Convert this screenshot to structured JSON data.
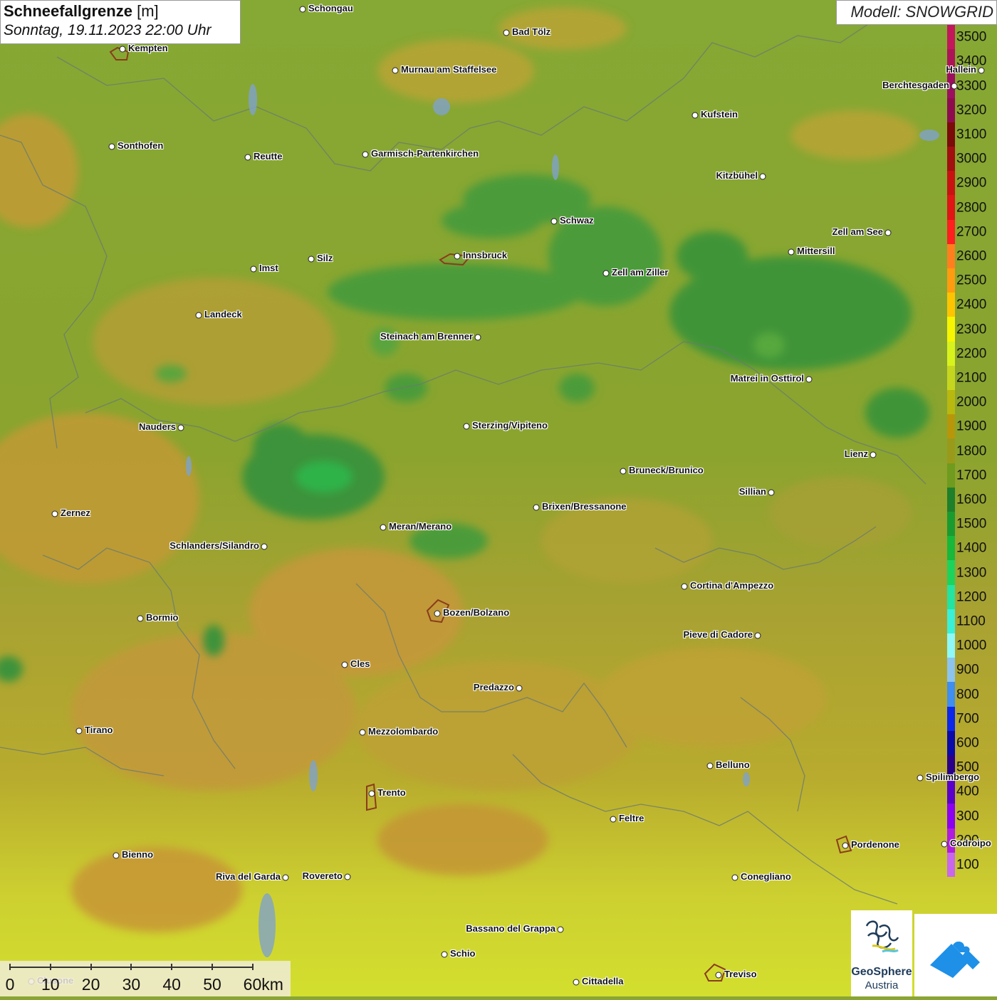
{
  "header": {
    "title_bold": "Schneefallgrenze",
    "title_unit": "[m]",
    "datetime": "Sonntag, 19.11.2023 22:00 Uhr",
    "model": "Modell: SNOWGRID"
  },
  "legend": {
    "values": [
      "3500",
      "3400",
      "3300",
      "3200",
      "3100",
      "3000",
      "2900",
      "2800",
      "2700",
      "2600",
      "2500",
      "2400",
      "2300",
      "2200",
      "2100",
      "2000",
      "1900",
      "1800",
      "1700",
      "1600",
      "1500",
      "1400",
      "1300",
      "1200",
      "1100",
      "1000",
      "900",
      "800",
      "700",
      "600",
      "500",
      "400",
      "300",
      "200",
      "100"
    ],
    "colors": [
      "#c2185b",
      "#ad1457",
      "#9c0f5f",
      "#8e0c4e",
      "#7b0a0a",
      "#a10f10",
      "#c81212",
      "#e01515",
      "#ff1f1f",
      "#ff7f1f",
      "#ff9b0f",
      "#ffc400",
      "#f7f500",
      "#d8f21c",
      "#c6d61e",
      "#b8b80f",
      "#b8960a",
      "#9a9a1a",
      "#6f9b1e",
      "#1f7f2a",
      "#1a9b2f",
      "#18b83a",
      "#1dd35c",
      "#25e3a0",
      "#3af0d6",
      "#8ff8f8",
      "#8cc4ee",
      "#3f8ef0",
      "#0b28e8",
      "#0a0aa8",
      "#2a0088",
      "#5a00c8",
      "#8c00f0",
      "#b01cde",
      "#c967ec"
    ]
  },
  "cities": [
    {
      "name": "Schongau",
      "label_side": "right"
    },
    {
      "name": "Bad Tölz",
      "label_side": "right"
    },
    {
      "name": "Kempten",
      "label_side": "right"
    },
    {
      "name": "Murnau am Staffelsee",
      "label_side": "right"
    },
    {
      "name": "Hallein",
      "label_side": "left"
    },
    {
      "name": "Berchtesgaden",
      "label_side": "left"
    },
    {
      "name": "Kufstein",
      "label_side": "right"
    },
    {
      "name": "Sonthofen",
      "label_side": "right"
    },
    {
      "name": "Reutte",
      "label_side": "right"
    },
    {
      "name": "Garmisch-Partenkirchen",
      "label_side": "right"
    },
    {
      "name": "Kitzbühel",
      "label_side": "left"
    },
    {
      "name": "Schwaz",
      "label_side": "right"
    },
    {
      "name": "Zell am See",
      "label_side": "left"
    },
    {
      "name": "Innsbruck",
      "label_side": "right"
    },
    {
      "name": "Mittersill",
      "label_side": "right"
    },
    {
      "name": "Silz",
      "label_side": "right"
    },
    {
      "name": "Imst",
      "label_side": "right"
    },
    {
      "name": "Zell am Ziller",
      "label_side": "right"
    },
    {
      "name": "Landeck",
      "label_side": "right"
    },
    {
      "name": "Steinach am Brenner",
      "label_side": "left"
    },
    {
      "name": "Matrei in Osttirol",
      "label_side": "left"
    },
    {
      "name": "Nauders",
      "label_side": "left"
    },
    {
      "name": "Sterzing/Vipiteno",
      "label_side": "right"
    },
    {
      "name": "Lienz",
      "label_side": "left"
    },
    {
      "name": "Bruneck/Brunico",
      "label_side": "right"
    },
    {
      "name": "Sillian",
      "label_side": "left"
    },
    {
      "name": "Brixen/Bressanone",
      "label_side": "right"
    },
    {
      "name": "Zernez",
      "label_side": "right"
    },
    {
      "name": "Meran/Merano",
      "label_side": "right"
    },
    {
      "name": "Schlanders/Silandro",
      "label_side": "left"
    },
    {
      "name": "Cortina d'Ampezzo",
      "label_side": "right"
    },
    {
      "name": "Bozen/Bolzano",
      "label_side": "right"
    },
    {
      "name": "Bormio",
      "label_side": "right"
    },
    {
      "name": "Pieve di Cadore",
      "label_side": "left"
    },
    {
      "name": "Cles",
      "label_side": "right"
    },
    {
      "name": "Predazzo",
      "label_side": "left"
    },
    {
      "name": "Tirano",
      "label_side": "right"
    },
    {
      "name": "Mezzolombardo",
      "label_side": "right"
    },
    {
      "name": "Belluno",
      "label_side": "right"
    },
    {
      "name": "Spilimbergo",
      "label_side": "right"
    },
    {
      "name": "Trento",
      "label_side": "right"
    },
    {
      "name": "Feltre",
      "label_side": "right"
    },
    {
      "name": "Pordenone",
      "label_side": "right"
    },
    {
      "name": "Codroipo",
      "label_side": "right"
    },
    {
      "name": "Bienno",
      "label_side": "right"
    },
    {
      "name": "Riva del Garda",
      "label_side": "left"
    },
    {
      "name": "Rovereto",
      "label_side": "left"
    },
    {
      "name": "Conegliano",
      "label_side": "right"
    },
    {
      "name": "Bassano del Grappa",
      "label_side": "left"
    },
    {
      "name": "Schio",
      "label_side": "right"
    },
    {
      "name": "Treviso",
      "label_side": "right"
    },
    {
      "name": "Cittadella",
      "label_side": "right"
    },
    {
      "name": "Clusone",
      "label_side": "right"
    }
  ],
  "scale_bar": {
    "labels": [
      "0",
      "10",
      "20",
      "30",
      "40",
      "50",
      "60km"
    ]
  },
  "logos": {
    "geosphere_line1": "GeoSphere",
    "geosphere_line2": "Austria"
  }
}
